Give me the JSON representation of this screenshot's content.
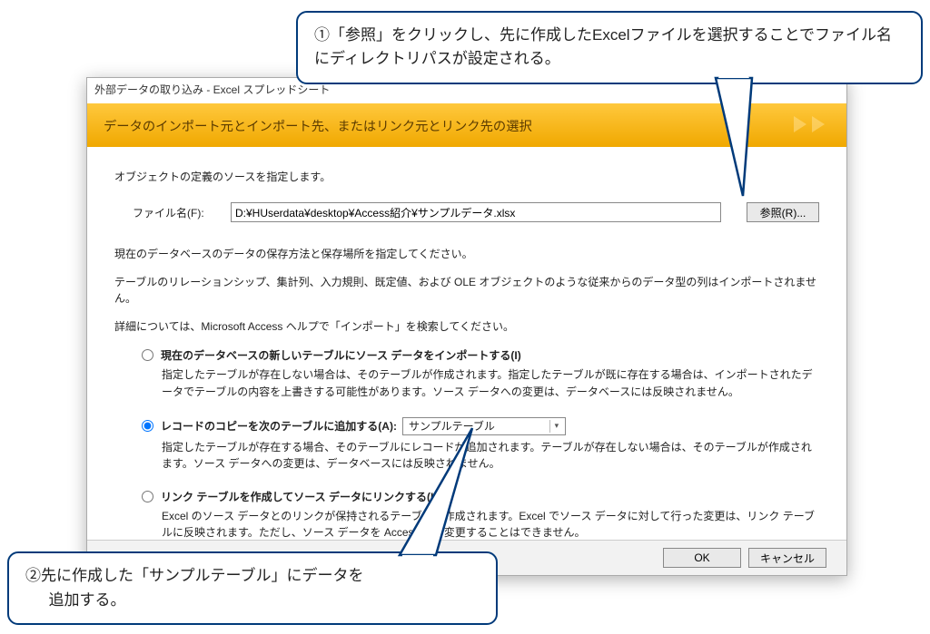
{
  "dialog": {
    "title": "外部データの取り込み - Excel スプレッドシート",
    "banner": "データのインポート元とインポート先、またはリンク元とリンク先の選択",
    "intro": "オブジェクトの定義のソースを指定します。",
    "file": {
      "label": "ファイル名(F):",
      "value": "D:¥HUserdata¥desktop¥Access紹介¥サンプルデータ.xlsx",
      "browse": "参照(R)..."
    },
    "para1": "現在のデータベースのデータの保存方法と保存場所を指定してください。",
    "para2": "テーブルのリレーションシップ、集計列、入力規則、既定値、および OLE オブジェクトのような従来からのデータ型の列はインポートされません。",
    "para3": "詳細については、Microsoft Access ヘルプで「インポート」を検索してください。",
    "opt1": {
      "label": "現在のデータベースの新しいテーブルにソース データをインポートする(I)",
      "desc": "指定したテーブルが存在しない場合は、そのテーブルが作成されます。指定したテーブルが既に存在する場合は、インポートされたデータでテーブルの内容を上書きする可能性があります。ソース データへの変更は、データベースには反映されません。"
    },
    "opt2": {
      "label": "レコードのコピーを次のテーブルに追加する(A):",
      "combo": "サンプルテーブル",
      "desc": "指定したテーブルが存在する場合、そのテーブルにレコードが追加されます。テーブルが存在しない場合は、そのテーブルが作成されます。ソース データへの変更は、データベースには反映されません。"
    },
    "opt3": {
      "label": "リンク テーブルを作成してソース データにリンクする(L)",
      "desc": "Excel のソース データとのリンクが保持されるテーブルが作成されます。Excel でソース データに対して行った変更は、リンク テーブルに反映されます。ただし、ソース データを Access から変更することはできません。"
    },
    "ok": "OK",
    "cancel": "キャンセル"
  },
  "callout1": "①「参照」をクリックし、先に作成したExcelファイルを選択することでファイル名にディレクトリパスが設定される。",
  "callout2_l1": "②先に作成した「サンプルテーブル」にデータを",
  "callout2_l2": "追加する。"
}
